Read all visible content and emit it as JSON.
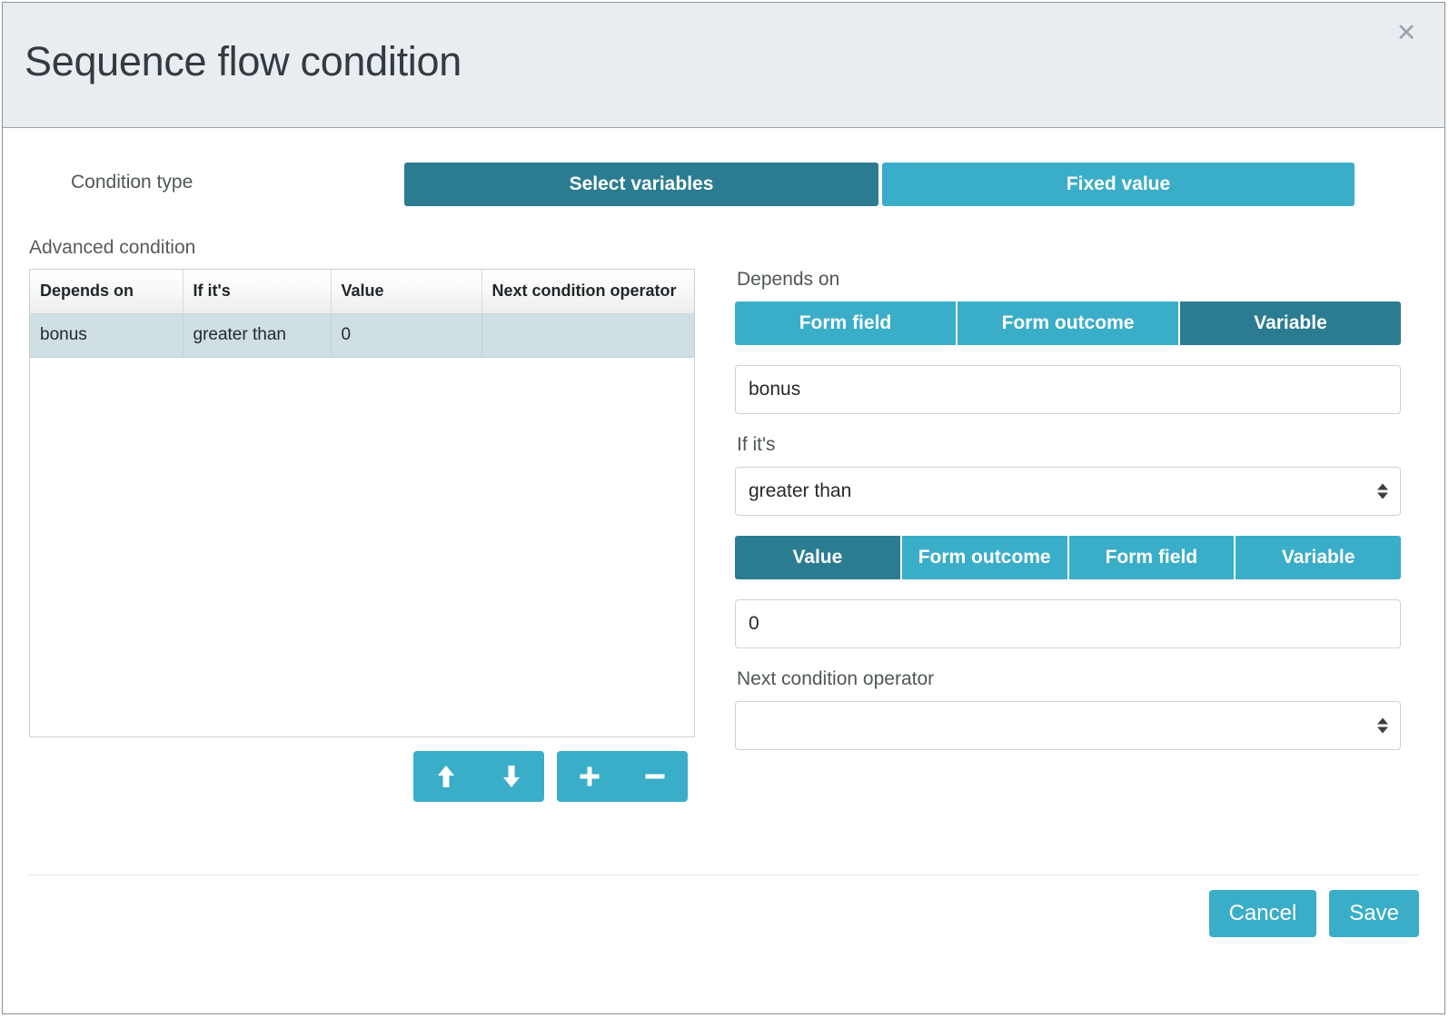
{
  "dialog": {
    "title": "Sequence flow condition",
    "close_icon": "close-icon"
  },
  "condition_type": {
    "label": "Condition type",
    "options": [
      {
        "label": "Select variables",
        "active": true
      },
      {
        "label": "Fixed value",
        "active": false
      }
    ]
  },
  "advanced_condition": {
    "label": "Advanced condition",
    "table": {
      "columns": [
        "Depends on",
        "If it's",
        "Value",
        "Next condition operator"
      ],
      "rows": [
        {
          "depends_on": "bonus",
          "if_its": "greater than",
          "value": "0",
          "next_condition_operator": ""
        }
      ]
    },
    "actions": [
      {
        "name": "move-up",
        "icon": "arrow-up-icon"
      },
      {
        "name": "move-down",
        "icon": "arrow-down-icon"
      },
      {
        "name": "add-condition",
        "icon": "plus-icon"
      },
      {
        "name": "remove-condition",
        "icon": "minus-icon"
      }
    ]
  },
  "editor": {
    "depends_on": {
      "label": "Depends on",
      "options": [
        {
          "label": "Form field",
          "active": false
        },
        {
          "label": "Form outcome",
          "active": false
        },
        {
          "label": "Variable",
          "active": true
        }
      ],
      "value": "bonus",
      "placeholder": ""
    },
    "operator": {
      "label": "If it's",
      "value": "greater than"
    },
    "value_source": {
      "options": [
        {
          "label": "Value",
          "active": true
        },
        {
          "label": "Form outcome",
          "active": false
        },
        {
          "label": "Form field",
          "active": false
        },
        {
          "label": "Variable",
          "active": false
        }
      ],
      "value": "0",
      "placeholder": ""
    },
    "next_condition_operator": {
      "label": "Next condition operator",
      "value": ""
    }
  },
  "footer": {
    "cancel_label": "Cancel",
    "save_label": "Save"
  },
  "colors": {
    "accent": "#3aadc9",
    "accent_active": "#2b7c90",
    "header_bg": "#e8edf1",
    "row_selected": "#cfdfe3"
  }
}
